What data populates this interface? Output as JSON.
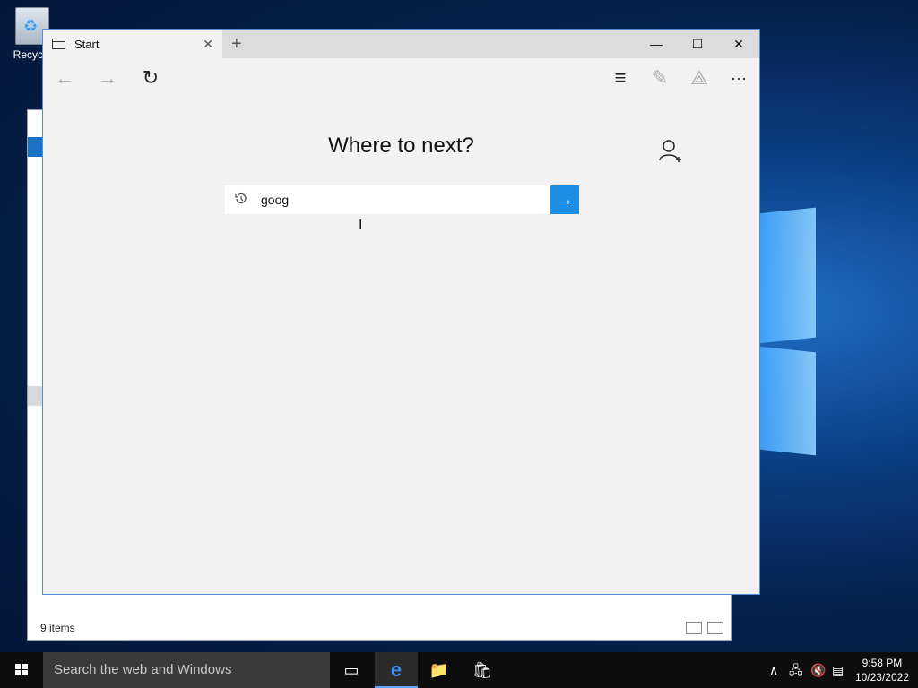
{
  "desktop": {
    "recycle_bin_label": "Recycle"
  },
  "explorer": {
    "status_text": "9 items"
  },
  "browser": {
    "tab_title": "Start",
    "tab_close_icon": "✕",
    "new_tab_icon": "+",
    "minimize_icon": "—",
    "maximize_icon": "☐",
    "close_icon": "✕",
    "back_icon": "←",
    "forward_icon": "→",
    "refresh_icon": "↻",
    "hub_icon": "≡",
    "note_icon": "✎",
    "share_icon": "⟁",
    "more_icon": "···",
    "headline": "Where to next?",
    "search_value": "goog",
    "go_icon": "→"
  },
  "taskbar": {
    "search_placeholder": "Search the web and Windows",
    "task_view_icon": "▭",
    "edge_icon": "e",
    "explorer_icon": "📁",
    "store_icon": "🛍",
    "tray_chevron": "∧",
    "time": "9:58 PM",
    "date": "10/23/2022"
  },
  "colors": {
    "accent": "#1e8fe6"
  }
}
